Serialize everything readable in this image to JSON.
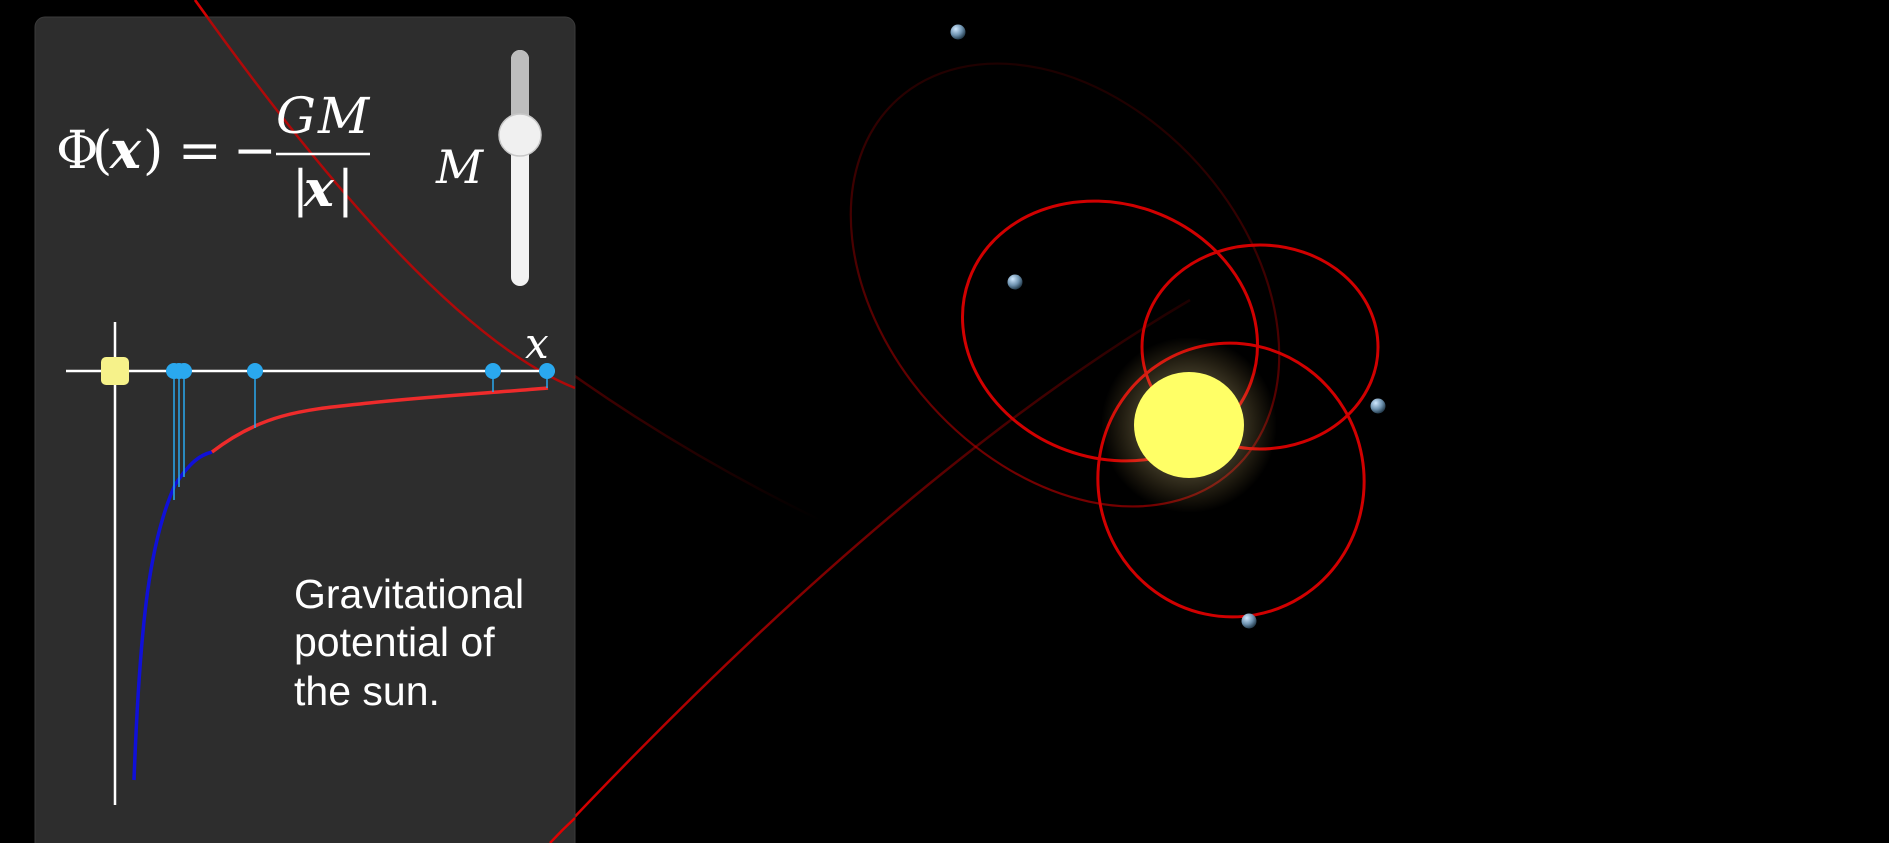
{
  "formula": {
    "lhs_phi": "Φ",
    "lhs_paren_open": "(",
    "lhs_var": "x",
    "lhs_paren_close": ")",
    "equals": "=",
    "minus": "−",
    "numerator_g": "G",
    "numerator_m": "M",
    "denom_bar_left": "|",
    "denom_var": "x",
    "denom_bar_right": "|"
  },
  "slider": {
    "label": "M",
    "value_fraction": 0.33
  },
  "graph": {
    "x_axis_label": "x"
  },
  "caption": {
    "line1": "Gravitational",
    "line2": "potential of",
    "line3": "the sun."
  },
  "colors": {
    "panel": "#2d2d2d",
    "orbit": "#d10000",
    "potential_near": "#1010d8",
    "potential_far": "#ee2b2b",
    "marker": "#2aa8ee",
    "sun": "#ffff66"
  }
}
